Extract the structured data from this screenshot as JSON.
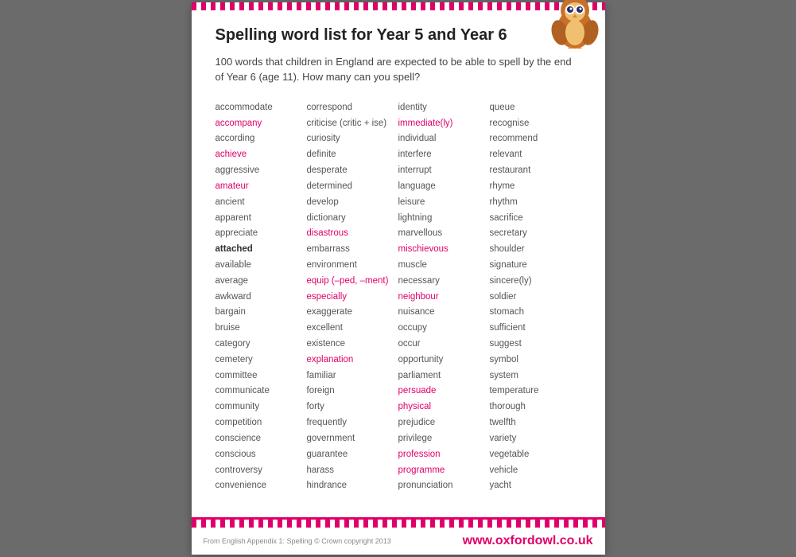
{
  "page": {
    "title": "Spelling word list for Year 5 and Year 6",
    "subtitle": "100 words that children in England are expected to be able to spell by the end of Year 6 (age 11). How many can you spell?",
    "copyright": "From English Appendix 1: Spelling  © Crown copyright 2013",
    "website": "www.oxfordowl.co.uk"
  },
  "columns": [
    {
      "words": [
        {
          "text": "accommodate",
          "style": "normal"
        },
        {
          "text": "accompany",
          "style": "highlight"
        },
        {
          "text": "according",
          "style": "normal"
        },
        {
          "text": "achieve",
          "style": "highlight"
        },
        {
          "text": "aggressive",
          "style": "normal"
        },
        {
          "text": "amateur",
          "style": "highlight"
        },
        {
          "text": "ancient",
          "style": "normal"
        },
        {
          "text": "apparent",
          "style": "normal"
        },
        {
          "text": "appreciate",
          "style": "normal"
        },
        {
          "text": "attached",
          "style": "bold"
        },
        {
          "text": "available",
          "style": "normal"
        },
        {
          "text": "average",
          "style": "normal"
        },
        {
          "text": "awkward",
          "style": "normal"
        },
        {
          "text": "bargain",
          "style": "normal"
        },
        {
          "text": "bruise",
          "style": "normal"
        },
        {
          "text": "category",
          "style": "normal"
        },
        {
          "text": "cemetery",
          "style": "normal"
        },
        {
          "text": "committee",
          "style": "normal"
        },
        {
          "text": "communicate",
          "style": "normal"
        },
        {
          "text": "community",
          "style": "normal"
        },
        {
          "text": "competition",
          "style": "normal"
        },
        {
          "text": "conscience",
          "style": "normal"
        },
        {
          "text": "conscious",
          "style": "normal"
        },
        {
          "text": "controversy",
          "style": "normal"
        },
        {
          "text": "convenience",
          "style": "normal"
        }
      ]
    },
    {
      "words": [
        {
          "text": "correspond",
          "style": "normal"
        },
        {
          "text": "criticise (critic + ise)",
          "style": "normal"
        },
        {
          "text": "curiosity",
          "style": "normal"
        },
        {
          "text": "definite",
          "style": "normal"
        },
        {
          "text": "desperate",
          "style": "normal"
        },
        {
          "text": "determined",
          "style": "normal"
        },
        {
          "text": "develop",
          "style": "normal"
        },
        {
          "text": "dictionary",
          "style": "normal"
        },
        {
          "text": "disastrous",
          "style": "highlight"
        },
        {
          "text": "embarrass",
          "style": "normal"
        },
        {
          "text": "environment",
          "style": "normal"
        },
        {
          "text": "equip (–ped, –ment)",
          "style": "highlight"
        },
        {
          "text": "especially",
          "style": "highlight"
        },
        {
          "text": "exaggerate",
          "style": "normal"
        },
        {
          "text": "excellent",
          "style": "normal"
        },
        {
          "text": "existence",
          "style": "normal"
        },
        {
          "text": "explanation",
          "style": "highlight"
        },
        {
          "text": "familiar",
          "style": "normal"
        },
        {
          "text": "foreign",
          "style": "normal"
        },
        {
          "text": "forty",
          "style": "normal"
        },
        {
          "text": "frequently",
          "style": "normal"
        },
        {
          "text": "government",
          "style": "normal"
        },
        {
          "text": "guarantee",
          "style": "normal"
        },
        {
          "text": "harass",
          "style": "normal"
        },
        {
          "text": "hindrance",
          "style": "normal"
        }
      ]
    },
    {
      "words": [
        {
          "text": "identity",
          "style": "normal"
        },
        {
          "text": "immediate(ly)",
          "style": "highlight"
        },
        {
          "text": "individual",
          "style": "normal"
        },
        {
          "text": "interfere",
          "style": "normal"
        },
        {
          "text": "interrupt",
          "style": "normal"
        },
        {
          "text": "language",
          "style": "normal"
        },
        {
          "text": "leisure",
          "style": "normal"
        },
        {
          "text": "lightning",
          "style": "normal"
        },
        {
          "text": "marvellous",
          "style": "normal"
        },
        {
          "text": "mischievous",
          "style": "highlight"
        },
        {
          "text": "muscle",
          "style": "normal"
        },
        {
          "text": "necessary",
          "style": "normal"
        },
        {
          "text": "neighbour",
          "style": "highlight"
        },
        {
          "text": "nuisance",
          "style": "normal"
        },
        {
          "text": "occupy",
          "style": "normal"
        },
        {
          "text": "occur",
          "style": "normal"
        },
        {
          "text": "opportunity",
          "style": "normal"
        },
        {
          "text": "parliament",
          "style": "normal"
        },
        {
          "text": "persuade",
          "style": "highlight"
        },
        {
          "text": "physical",
          "style": "highlight"
        },
        {
          "text": "prejudice",
          "style": "normal"
        },
        {
          "text": "privilege",
          "style": "normal"
        },
        {
          "text": "profession",
          "style": "highlight"
        },
        {
          "text": "programme",
          "style": "highlight"
        },
        {
          "text": "pronunciation",
          "style": "normal"
        }
      ]
    },
    {
      "words": [
        {
          "text": "queue",
          "style": "normal"
        },
        {
          "text": "recognise",
          "style": "normal"
        },
        {
          "text": "recommend",
          "style": "normal"
        },
        {
          "text": "relevant",
          "style": "normal"
        },
        {
          "text": "restaurant",
          "style": "normal"
        },
        {
          "text": "rhyme",
          "style": "normal"
        },
        {
          "text": "rhythm",
          "style": "normal"
        },
        {
          "text": "sacrifice",
          "style": "normal"
        },
        {
          "text": "secretary",
          "style": "normal"
        },
        {
          "text": "shoulder",
          "style": "normal"
        },
        {
          "text": "signature",
          "style": "normal"
        },
        {
          "text": "sincere(ly)",
          "style": "normal"
        },
        {
          "text": "soldier",
          "style": "normal"
        },
        {
          "text": "stomach",
          "style": "normal"
        },
        {
          "text": "sufficient",
          "style": "normal"
        },
        {
          "text": "suggest",
          "style": "normal"
        },
        {
          "text": "symbol",
          "style": "normal"
        },
        {
          "text": "system",
          "style": "normal"
        },
        {
          "text": "temperature",
          "style": "normal"
        },
        {
          "text": "thorough",
          "style": "normal"
        },
        {
          "text": "twelfth",
          "style": "normal"
        },
        {
          "text": "variety",
          "style": "normal"
        },
        {
          "text": "vegetable",
          "style": "normal"
        },
        {
          "text": "vehicle",
          "style": "normal"
        },
        {
          "text": "yacht",
          "style": "normal"
        }
      ]
    }
  ]
}
